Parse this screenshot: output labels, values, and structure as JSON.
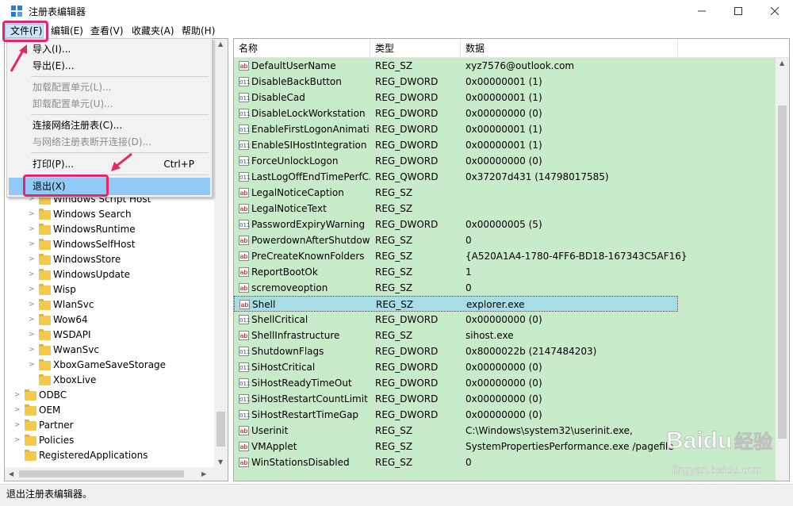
{
  "window": {
    "title": "注册表编辑器"
  },
  "menubar": [
    "文件(F)",
    "编辑(E)",
    "查看(V)",
    "收藏夹(A)",
    "帮助(H)"
  ],
  "file_menu": {
    "import": "导入(I)...",
    "export": "导出(E)...",
    "load_hive": "加载配置单元(L)...",
    "unload_hive": "卸载配置单元(U)...",
    "connect": "连接网络注册表(C)...",
    "disconnect": "与网络注册表断开连接(D)...",
    "print": "打印(P)...",
    "print_shortcut": "Ctrl+P",
    "exit": "退出(X)"
  },
  "tree": {
    "partial_top": "Windows Script Host",
    "items": [
      "Windows Search",
      "WindowsRuntime",
      "WindowsSelfHost",
      "WindowsStore",
      "WindowsUpdate",
      "Wisp",
      "WlanSvc",
      "Wow64",
      "WSDAPI",
      "WwanSvc",
      "XboxGameSaveStorage",
      "XboxLive"
    ],
    "root_items": [
      "ODBC",
      "OEM",
      "Partner",
      "Policies",
      "RegisteredApplications"
    ]
  },
  "list": {
    "headers": [
      "名称",
      "类型",
      "数据"
    ],
    "rows": [
      {
        "name": "DefaultUserName",
        "type": "REG_SZ",
        "data": "xyz7576@outlook.com",
        "icon": "ab"
      },
      {
        "name": "DisableBackButton",
        "type": "REG_DWORD",
        "data": "0x00000001 (1)",
        "icon": "bin"
      },
      {
        "name": "DisableCad",
        "type": "REG_DWORD",
        "data": "0x00000001 (1)",
        "icon": "bin"
      },
      {
        "name": "DisableLockWorkstation",
        "type": "REG_DWORD",
        "data": "0x00000000 (0)",
        "icon": "bin"
      },
      {
        "name": "EnableFirstLogonAnimati...",
        "type": "REG_DWORD",
        "data": "0x00000001 (1)",
        "icon": "bin"
      },
      {
        "name": "EnableSIHostIntegration",
        "type": "REG_DWORD",
        "data": "0x00000001 (1)",
        "icon": "bin"
      },
      {
        "name": "ForceUnlockLogon",
        "type": "REG_DWORD",
        "data": "0x00000000 (0)",
        "icon": "bin"
      },
      {
        "name": "LastLogOffEndTimePerfC...",
        "type": "REG_QWORD",
        "data": "0x37207d431 (14798017585)",
        "icon": "bin"
      },
      {
        "name": "LegalNoticeCaption",
        "type": "REG_SZ",
        "data": "",
        "icon": "ab"
      },
      {
        "name": "LegalNoticeText",
        "type": "REG_SZ",
        "data": "",
        "icon": "ab"
      },
      {
        "name": "PasswordExpiryWarning",
        "type": "REG_DWORD",
        "data": "0x00000005 (5)",
        "icon": "bin"
      },
      {
        "name": "PowerdownAfterShutdown",
        "type": "REG_SZ",
        "data": "0",
        "icon": "ab"
      },
      {
        "name": "PreCreateKnownFolders",
        "type": "REG_SZ",
        "data": "{A520A1A4-1780-4FF6-BD18-167343C5AF16}",
        "icon": "ab"
      },
      {
        "name": "ReportBootOk",
        "type": "REG_SZ",
        "data": "1",
        "icon": "ab"
      },
      {
        "name": "scremoveoption",
        "type": "REG_SZ",
        "data": "0",
        "icon": "ab"
      },
      {
        "name": "Shell",
        "type": "REG_SZ",
        "data": "explorer.exe",
        "icon": "ab"
      },
      {
        "name": "ShellCritical",
        "type": "REG_DWORD",
        "data": "0x00000000 (0)",
        "icon": "bin"
      },
      {
        "name": "ShellInfrastructure",
        "type": "REG_SZ",
        "data": "sihost.exe",
        "icon": "ab"
      },
      {
        "name": "ShutdownFlags",
        "type": "REG_DWORD",
        "data": "0x8000022b (2147484203)",
        "icon": "bin"
      },
      {
        "name": "SiHostCritical",
        "type": "REG_DWORD",
        "data": "0x00000000 (0)",
        "icon": "bin"
      },
      {
        "name": "SiHostReadyTimeOut",
        "type": "REG_DWORD",
        "data": "0x00000000 (0)",
        "icon": "bin"
      },
      {
        "name": "SiHostRestartCountLimit",
        "type": "REG_DWORD",
        "data": "0x00000000 (0)",
        "icon": "bin"
      },
      {
        "name": "SiHostRestartTimeGap",
        "type": "REG_DWORD",
        "data": "0x00000000 (0)",
        "icon": "bin"
      },
      {
        "name": "Userinit",
        "type": "REG_SZ",
        "data": "C:\\Windows\\system32\\userinit.exe,",
        "icon": "ab"
      },
      {
        "name": "VMApplet",
        "type": "REG_SZ",
        "data": "SystemPropertiesPerformance.exe /pagefile",
        "icon": "ab"
      },
      {
        "name": "WinStationsDisabled",
        "type": "REG_SZ",
        "data": "0",
        "icon": "ab"
      }
    ]
  },
  "status": {
    "text": "退出注册表编辑器。"
  },
  "watermark": {
    "brand": "Baidu",
    "cn": "经验",
    "url": "jingyan.baidu.com"
  },
  "colors": {
    "list_background": "#c8ebc9",
    "selected_row": "#a9dde6",
    "annotation": "#e8246a",
    "menu_highlight": "#91c9f7"
  }
}
